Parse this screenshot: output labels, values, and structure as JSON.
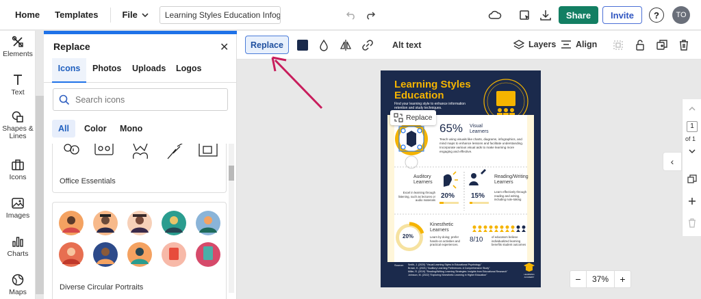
{
  "topbar": {
    "home": "Home",
    "templates": "Templates",
    "file": "File",
    "doc_title": "Learning Styles Education Infographic",
    "share": "Share",
    "invite": "Invite",
    "help": "?",
    "avatar": "TO"
  },
  "rail": {
    "items": [
      "Elements",
      "Text",
      "Shapes &",
      "Lines",
      "Icons",
      "Images",
      "Charts",
      "Maps"
    ]
  },
  "panel": {
    "title": "Replace",
    "tabs": [
      "Icons",
      "Photos",
      "Uploads",
      "Logos"
    ],
    "search_placeholder": "Search icons",
    "filters": [
      "All",
      "Color",
      "Mono"
    ],
    "sections": [
      "Office Essentials",
      "Diverse Circular Portraits"
    ]
  },
  "toolbar": {
    "replace": "Replace",
    "alt_text": "Alt text",
    "layers": "Layers",
    "align": "Align",
    "swatch_color": "#1a2a4c"
  },
  "infographic": {
    "title_line1": "Learning Styles",
    "title_line2": "Education",
    "subtitle": "Find your learning style to enhance information retention and study techniques.",
    "visual_pct": "65%",
    "visual_label1": "Visual",
    "visual_label2": "Learners",
    "visual_text": "Teach using visuals like charts, diagrams, infographics, and mind maps to enhance lessons and facilitate understanding. Incorporate various visual aids to make learning more engaging and effective.",
    "auditory_label1": "Auditory",
    "auditory_label2": "Learners",
    "auditory_text": "Excel in learning through listening, such as lectures or audio materials",
    "auditory_pct": "20%",
    "rw_label1": "Reading/Writing",
    "rw_label2": "Learners",
    "rw_text": "Learn effectively through reading and writing, including note-taking",
    "rw_pct": "15%",
    "kin_pct": "20%",
    "kin_label1": "Kinesthetic",
    "kin_label2": "Learners",
    "kin_text": "Learn by doing; prefer hands-on activities and practical experiences.",
    "ratio": "8/10",
    "ratio_text": "of educators believe individualized learning benefits student outcomes",
    "source_label": "Source:",
    "sources": [
      "Smith, J. (2020) \"Visual Learning Styles in Educational Psychology\"",
      "Brown, K. (2021) \"Auditory Learning Preferences: A Comprehensive Study\"",
      "Miller, R. (2019) \"Reading/Writing Learning Strategies: Insights from Educational Research\"",
      "Johnson, M. (2022) \"Exploring Kinesthetic Learning in Higher Education\""
    ],
    "logo_text": "LEARNING ACADEMY",
    "float_replace": "Replace",
    "navy": "#1b2a4c",
    "gold": "#f5b400",
    "cream": "#fff6da"
  },
  "page_nav": {
    "page": "1",
    "of": "of 1"
  },
  "zoom": {
    "minus": "−",
    "value": "37%",
    "plus": "+"
  }
}
